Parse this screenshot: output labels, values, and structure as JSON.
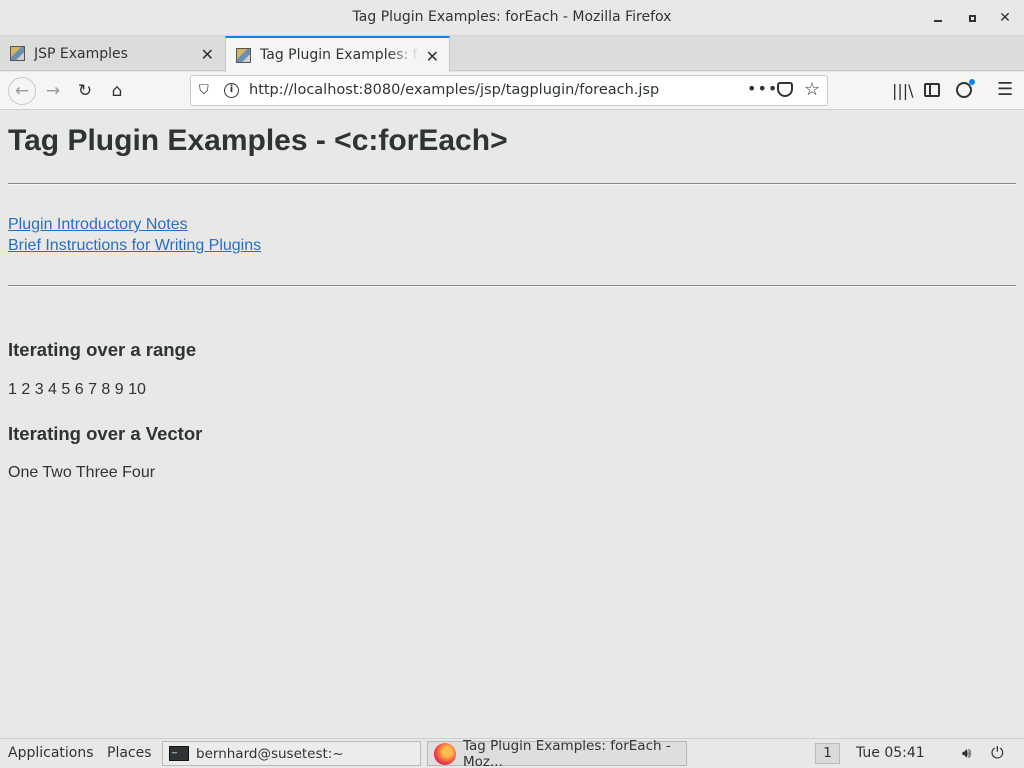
{
  "window": {
    "title": "Tag Plugin Examples: forEach - Mozilla Firefox"
  },
  "tabs": [
    {
      "label": "JSP Examples",
      "active": false
    },
    {
      "label": "Tag Plugin Examples: forEach",
      "active": true
    }
  ],
  "navbar": {
    "url": "http://localhost:8080/examples/jsp/tagplugin/foreach.jsp",
    "more_glyph": "•••"
  },
  "page": {
    "heading": "Tag Plugin Examples - <c:forEach>",
    "links": [
      {
        "label": "Plugin Introductory Notes"
      },
      {
        "label": "Brief Instructions for Writing Plugins"
      }
    ],
    "sections": [
      {
        "title": "Iterating over a range",
        "content": "1 2 3 4 5 6 7 8 9 10"
      },
      {
        "title": "Iterating over a Vector",
        "content": "One Two Three Four"
      }
    ],
    "link_color": "#2a6fbf"
  },
  "taskbar": {
    "applications": "Applications",
    "places": "Places",
    "windows": [
      {
        "label": "bernhard@susetest:~",
        "icon": "terminal-icon"
      },
      {
        "label": "Tag Plugin Examples: forEach - Moz...",
        "icon": "firefox-icon"
      }
    ],
    "workspace": "1",
    "clock": "Tue 05:41"
  }
}
